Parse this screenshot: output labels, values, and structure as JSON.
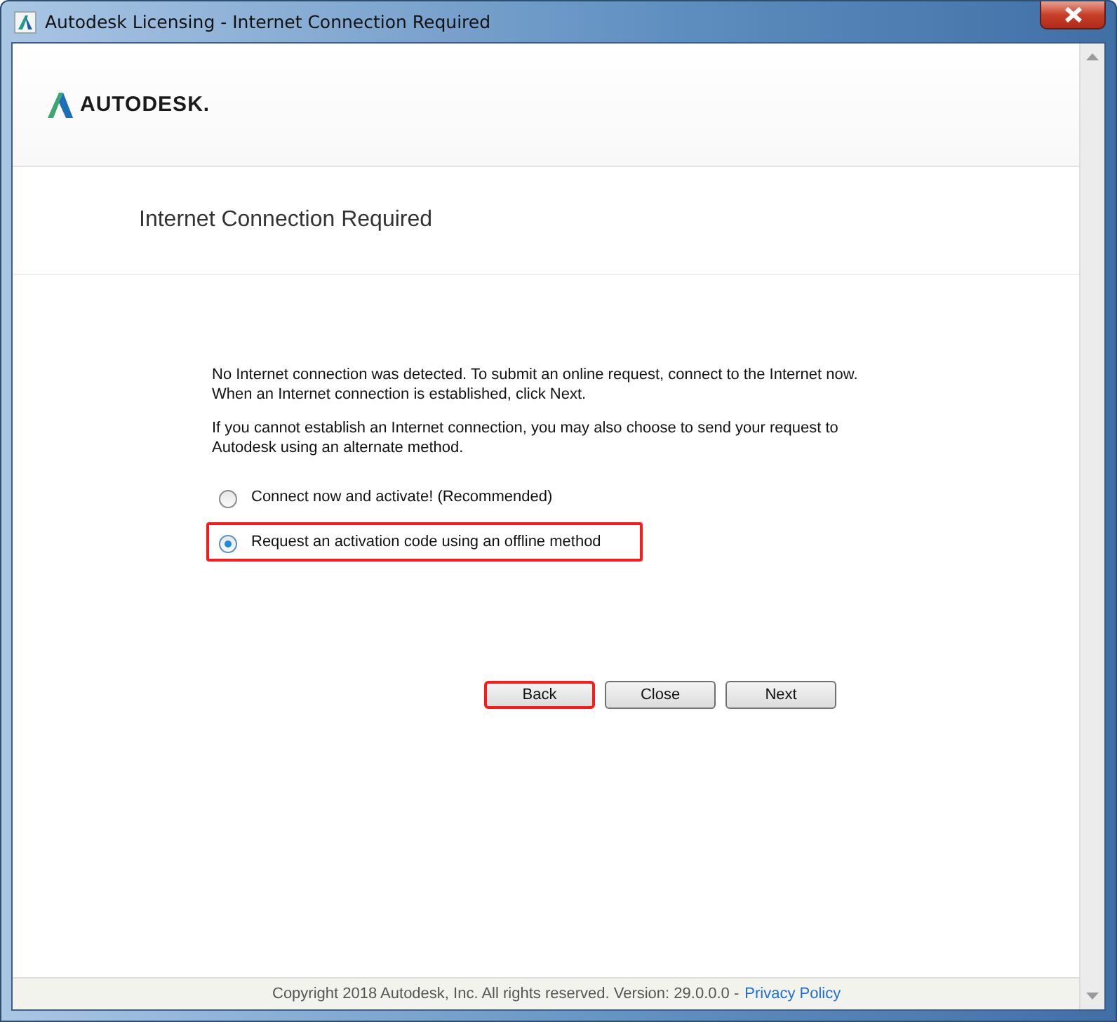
{
  "window": {
    "title": "Autodesk Licensing - Internet Connection Required"
  },
  "logo": {
    "text": "AUTODESK."
  },
  "heading": "Internet Connection Required",
  "paragraphs": [
    "No Internet connection was detected. To submit an online request, connect to the Internet now. When an Internet connection is established, click Next.",
    "If you cannot establish an Internet connection, you may also choose to send your request to Autodesk using an alternate method."
  ],
  "options": [
    {
      "label": "Connect now and activate! (Recommended)",
      "selected": false,
      "highlighted": false
    },
    {
      "label": "Request an activation code using an offline method",
      "selected": true,
      "highlighted": true
    }
  ],
  "buttons": [
    {
      "label": "Back",
      "highlighted": true
    },
    {
      "label": "Close",
      "highlighted": false
    },
    {
      "label": "Next",
      "highlighted": false
    }
  ],
  "footer": {
    "text": "Copyright 2018 Autodesk, Inc. All rights reserved. Version: 29.0.0.0 -",
    "link": "Privacy Policy"
  }
}
